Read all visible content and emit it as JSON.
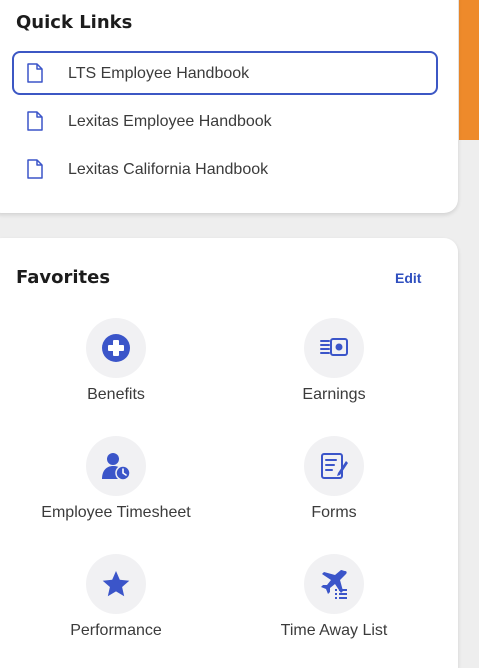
{
  "quick_links": {
    "title": "Quick Links",
    "items": [
      {
        "label": "LTS Employee Handbook",
        "icon": "document-icon",
        "selected": true
      },
      {
        "label": "Lexitas Employee Handbook",
        "icon": "document-icon",
        "selected": false
      },
      {
        "label": "Lexitas California Handbook",
        "icon": "document-icon",
        "selected": false
      }
    ]
  },
  "favorites": {
    "title": "Favorites",
    "edit_label": "Edit",
    "items": [
      {
        "label": "Benefits",
        "icon": "plus-circle-icon"
      },
      {
        "label": "Earnings",
        "icon": "money-stack-icon"
      },
      {
        "label": "Employee Timesheet",
        "icon": "user-clock-icon"
      },
      {
        "label": "Forms",
        "icon": "form-edit-icon"
      },
      {
        "label": "Performance",
        "icon": "star-icon"
      },
      {
        "label": "Time Away List",
        "icon": "plane-list-icon"
      }
    ]
  },
  "colors": {
    "accent": "#3c57c4",
    "icon_blue": "#3b55c9",
    "side_bar": "#ee8a2b"
  }
}
